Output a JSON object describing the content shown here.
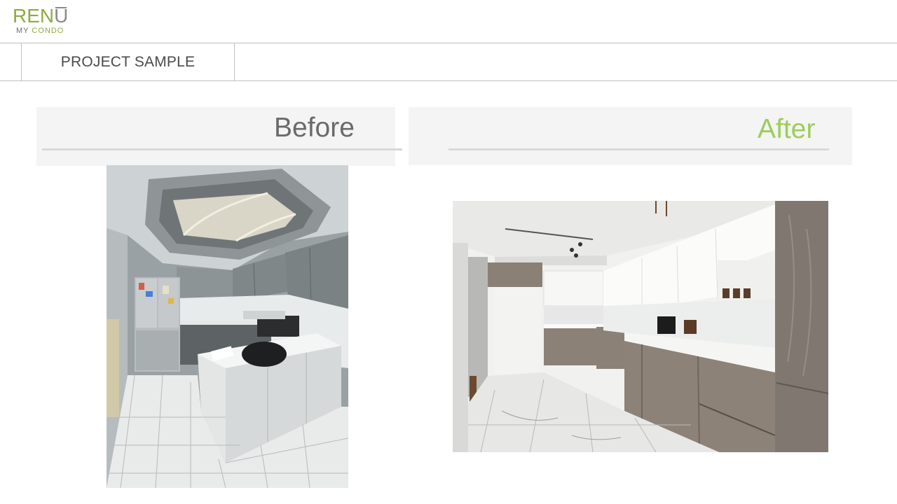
{
  "logo": {
    "main_left": "REN",
    "main_right": "U",
    "sub_left": "MY",
    "sub_right": "CONDO"
  },
  "header": {
    "title": "PROJECT SAMPLE"
  },
  "comparison": {
    "before_label": "Before",
    "after_label": "After"
  },
  "colors": {
    "brand_green": "#8cac3e",
    "after_green": "#9ccd5c",
    "text_gray": "#4a4a4a",
    "panel_bg": "#f4f4f4"
  }
}
